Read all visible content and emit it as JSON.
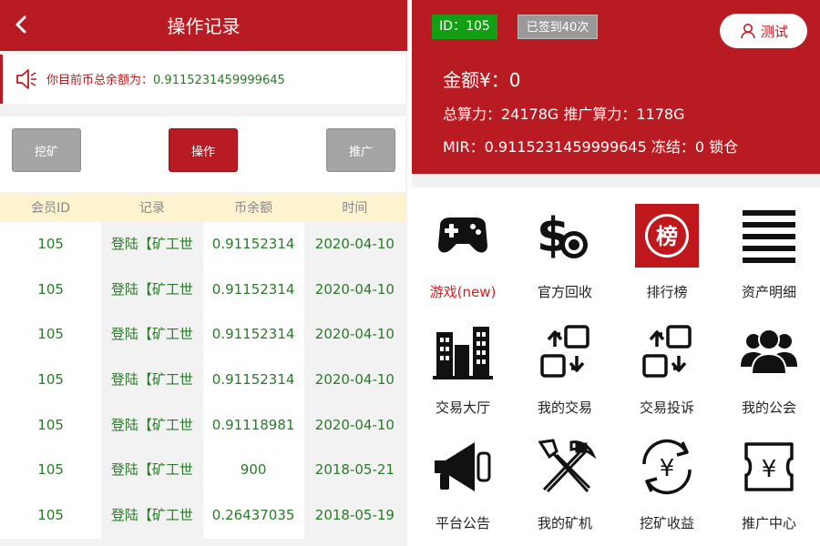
{
  "left": {
    "header": {
      "title": "操作记录"
    },
    "notice": {
      "label": "你目前币总余额为：",
      "value": "0.9115231459999645"
    },
    "tabs": [
      {
        "label": "挖矿"
      },
      {
        "label": "操作"
      },
      {
        "label": "推广"
      }
    ],
    "table": {
      "headers": [
        "会员ID",
        "记录",
        "币余额",
        "时间"
      ],
      "rows": [
        [
          "105",
          "登陆【矿工世",
          "0.91152314",
          "2020-04-10"
        ],
        [
          "105",
          "登陆【矿工世",
          "0.91152314",
          "2020-04-10"
        ],
        [
          "105",
          "登陆【矿工世",
          "0.91152314",
          "2020-04-10"
        ],
        [
          "105",
          "登陆【矿工世",
          "0.91152314",
          "2020-04-10"
        ],
        [
          "105",
          "登陆【矿工世",
          "0.91118981",
          "2020-04-10"
        ],
        [
          "105",
          "登陆【矿工世",
          "900",
          "2018-05-21"
        ],
        [
          "105",
          "登陆【矿工世",
          "0.26437035",
          "2018-05-19"
        ]
      ]
    }
  },
  "right": {
    "id_badge": "ID：105",
    "sign_badge": "已签到40次",
    "user_button": "测试",
    "amount": "金额¥：0",
    "power": "总算力：24178G 推广算力：1178G",
    "mir": "MIR：0.9115231459999645 冻结：0 锁仓",
    "menu": [
      {
        "label": "游戏(new)",
        "icon": "gamepad-icon"
      },
      {
        "label": "官方回收",
        "icon": "dollar-recycle-icon"
      },
      {
        "label": "排行榜",
        "icon": "ranking-badge-icon",
        "badge_text": "榜"
      },
      {
        "label": "资产明细",
        "icon": "list-lines-icon"
      },
      {
        "label": "交易大厅",
        "icon": "buildings-icon"
      },
      {
        "label": "我的交易",
        "icon": "exchange-arrows-icon"
      },
      {
        "label": "交易投诉",
        "icon": "exchange-arrows-icon"
      },
      {
        "label": "我的公会",
        "icon": "group-people-icon"
      },
      {
        "label": "平台公告",
        "icon": "megaphone-icon"
      },
      {
        "label": "我的矿机",
        "icon": "shovel-pickaxe-icon"
      },
      {
        "label": "挖矿收益",
        "icon": "yen-cycle-icon"
      },
      {
        "label": "推广中心",
        "icon": "yen-ticket-icon"
      }
    ]
  },
  "colors": {
    "brand_red": "#b81c22",
    "value_green": "#2a7a2a",
    "badge_green": "#139f13",
    "header_yellow": "#fdf3cf"
  }
}
